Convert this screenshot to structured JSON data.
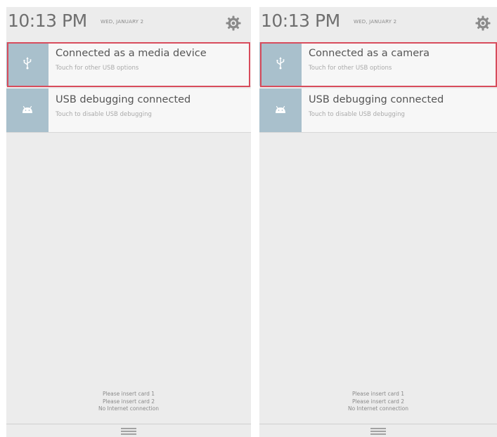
{
  "panels": [
    {
      "header": {
        "time": "10:13 PM",
        "date": "WED, JANUARY 2"
      },
      "notifications": [
        {
          "title": "Connected as a media device",
          "subtitle": "Touch for other USB options",
          "icon": "usb-icon",
          "highlighted": true
        },
        {
          "title": "USB debugging connected",
          "subtitle": "Touch to disable USB debugging",
          "icon": "android-debug-icon",
          "highlighted": false
        }
      ],
      "status_lines": [
        "Please insert card 1",
        "Please insert card 2",
        "No Internet connection"
      ]
    },
    {
      "header": {
        "time": "10:13 PM",
        "date": "WED, JANUARY 2"
      },
      "notifications": [
        {
          "title": "Connected as a camera",
          "subtitle": "Touch for other USB options",
          "icon": "usb-icon",
          "highlighted": true
        },
        {
          "title": "USB debugging connected",
          "subtitle": "Touch to disable USB debugging",
          "icon": "android-debug-icon",
          "highlighted": false
        }
      ],
      "status_lines": [
        "Please insert card 1",
        "Please insert card 2",
        "No Internet connection"
      ]
    }
  ],
  "colors": {
    "panel_background": "#ececec",
    "notification_background": "#f7f7f7",
    "icon_background": "#a9c0cc",
    "highlight_border": "#d84c5c",
    "time_text": "#6f6f6f"
  }
}
